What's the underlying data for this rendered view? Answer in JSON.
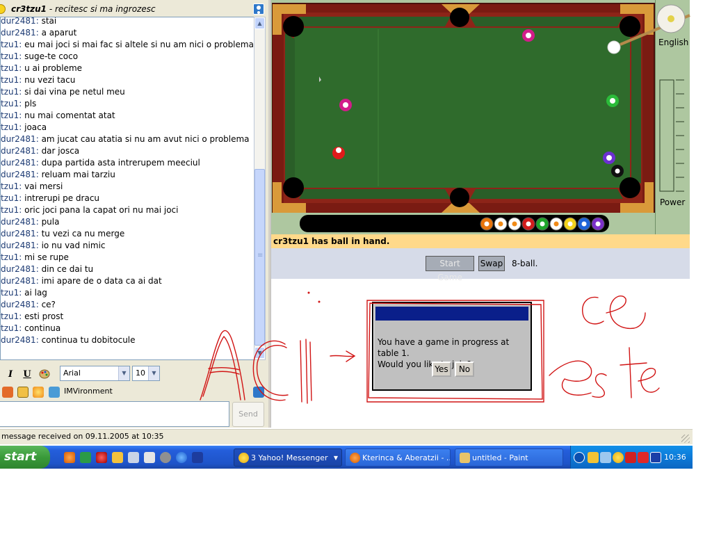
{
  "chat": {
    "header_name": "cr3tzu1",
    "header_status": " - recitesc si ma ingrozesc",
    "messages": [
      {
        "user": "dur2481",
        "text": "stai"
      },
      {
        "user": "dur2481",
        "text": "a aparut"
      },
      {
        "user": "tzu1",
        "text": "eu mai joci si mai fac si altele si nu am nici o problema"
      },
      {
        "user": "tzu1",
        "text": "suge-te coco"
      },
      {
        "user": "tzu1",
        "text": "u ai probleme"
      },
      {
        "user": "tzu1",
        "text": "nu vezi tacu"
      },
      {
        "user": "tzu1",
        "text": "si dai vina pe netul meu"
      },
      {
        "user": "tzu1",
        "text": "pls"
      },
      {
        "user": "tzu1",
        "text": "nu mai comentat atat"
      },
      {
        "user": "tzu1",
        "text": "joaca"
      },
      {
        "user": "dur2481",
        "text": "am jucat cau atatia si nu am avut nici o problema"
      },
      {
        "user": "dur2481",
        "text": "dar josca"
      },
      {
        "user": "dur2481",
        "text": "dupa partida asta intrerupem meeciul"
      },
      {
        "user": "dur2481",
        "text": "reluam mai tarziu"
      },
      {
        "user": "tzu1",
        "text": "vai mersi"
      },
      {
        "user": "tzu1",
        "text": "intrerupi pe dracu"
      },
      {
        "user": "tzu1",
        "text": "oric joci pana la capat ori nu mai joci"
      },
      {
        "user": "dur2481",
        "text": "pula"
      },
      {
        "user": "dur2481",
        "text": "tu vezi ca nu merge"
      },
      {
        "user": "dur2481",
        "text": "io nu vad nimic"
      },
      {
        "user": "tzu1",
        "text": "mi se rupe"
      },
      {
        "user": "dur2481",
        "text": "din ce dai tu"
      },
      {
        "user": "dur2481",
        "text": "imi apare de o data ca ai dat"
      },
      {
        "user": "tzu1",
        "text": "ai lag"
      },
      {
        "user": "dur2481",
        "text": "ce?"
      },
      {
        "user": "tzu1",
        "text": "esti prost"
      },
      {
        "user": "tzu1",
        "text": "continua"
      },
      {
        "user": "dur2481",
        "text": "continua tu dobitocule"
      }
    ],
    "font_name": "Arial",
    "font_size": "10",
    "imvironment_label": "IMVironment",
    "send_label": "Send",
    "status_text": "message received on 09.11.2005 at 10:35"
  },
  "game": {
    "english_label": "English",
    "power_label": "Power",
    "status_message": "cr3tzu1 has ball in hand.",
    "start_game_label": "Start Game",
    "swap_label": "Swap",
    "mode_label": "8-ball.",
    "tray_ball_colors": [
      "#e8740c",
      "#ffffff",
      "#ffffff",
      "#d11c1c",
      "#1fa52a",
      "#ffffff",
      "#f2d21b",
      "#1e63d8",
      "#7b2fc9"
    ]
  },
  "dialog": {
    "message_line1": "You have a game in progress at table 1.",
    "message_line2": "Would you like to join?",
    "yes_label": "Yes",
    "no_label": "No"
  },
  "taskbar": {
    "start_label": "start",
    "tasks": [
      {
        "label": "3 Yahoo! Messenger"
      },
      {
        "label": "Kterinca & Aberatzii - ..."
      },
      {
        "label": "untitled - Paint"
      }
    ],
    "clock": "10:36"
  },
  "colors": {
    "felt": "#2f6b2c",
    "rail": "#6b1d14",
    "handwriting": "#d11414",
    "taskbar": "#245edb"
  }
}
